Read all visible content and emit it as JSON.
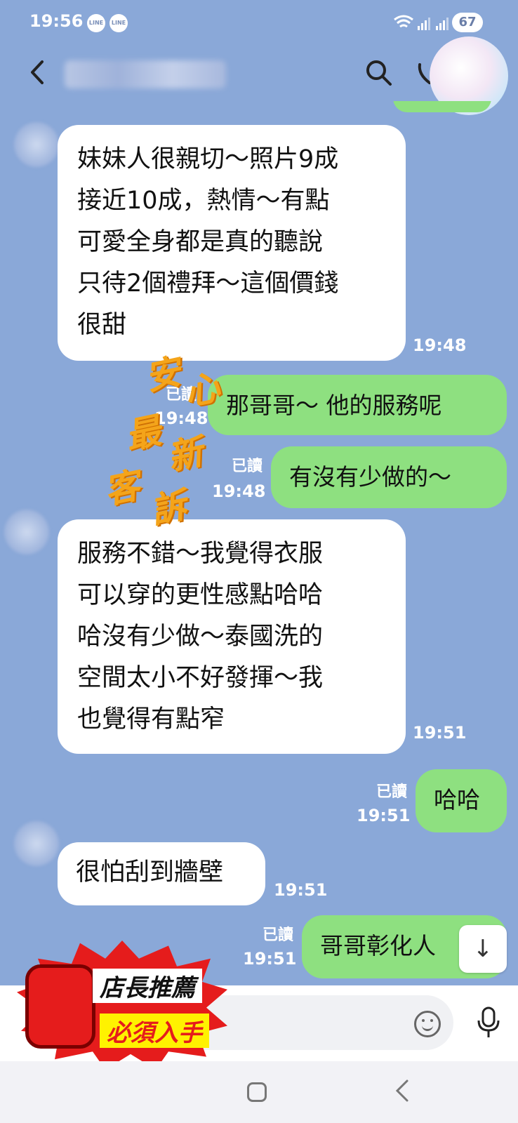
{
  "status_bar": {
    "time": "19:56",
    "notif_1": "LINE",
    "notif_2": "LINE",
    "wifi_icon": "wifi-icon",
    "battery": "67"
  },
  "header": {
    "back_icon": "chevron-left-icon",
    "search_icon": "search-icon",
    "call_icon": "phone-icon"
  },
  "messages": [
    {
      "side": "in",
      "lines": [
        "妹妹人很親切～照片9成",
        "接近10成，熱情～有點",
        "可愛全身都是真的聽說",
        "只待2個禮拜～這個價錢",
        "很甜"
      ],
      "time": "19:48"
    },
    {
      "side": "out",
      "text": "那哥哥～ 他的服務呢",
      "read": "已讀",
      "time": "19:48"
    },
    {
      "side": "out",
      "text": "有沒有少做的～",
      "read": "已讀",
      "time": "19:48"
    },
    {
      "side": "in",
      "lines": [
        "服務不錯～我覺得衣服",
        "可以穿的更性感點哈哈",
        "哈沒有少做～泰國洗的",
        "空間太小不好發揮～我",
        "也覺得有點窄"
      ],
      "time": "19:51"
    },
    {
      "side": "out",
      "text": "哈哈",
      "read": "已讀",
      "time": "19:51"
    },
    {
      "side": "in",
      "lines": [
        "很怕刮到牆壁"
      ],
      "time": "19:51"
    },
    {
      "side": "out",
      "text": "哥哥彰化人",
      "read": "已讀",
      "time": "19:51"
    }
  ],
  "watermark": {
    "chars": [
      "安",
      "心",
      "最",
      "新",
      "客",
      "訴"
    ]
  },
  "promo": {
    "line1": "店長推薦",
    "line2": "必須入手"
  },
  "input": {
    "emoji_icon": "emoji-icon",
    "mic_icon": "microphone-icon"
  },
  "scroll_icon": "↓",
  "colors": {
    "background": "#8aa8d8",
    "bubble_out": "#8ee080",
    "bubble_in": "#ffffff",
    "promo_red": "#e51c1c",
    "watermark": "#f4a41a"
  }
}
